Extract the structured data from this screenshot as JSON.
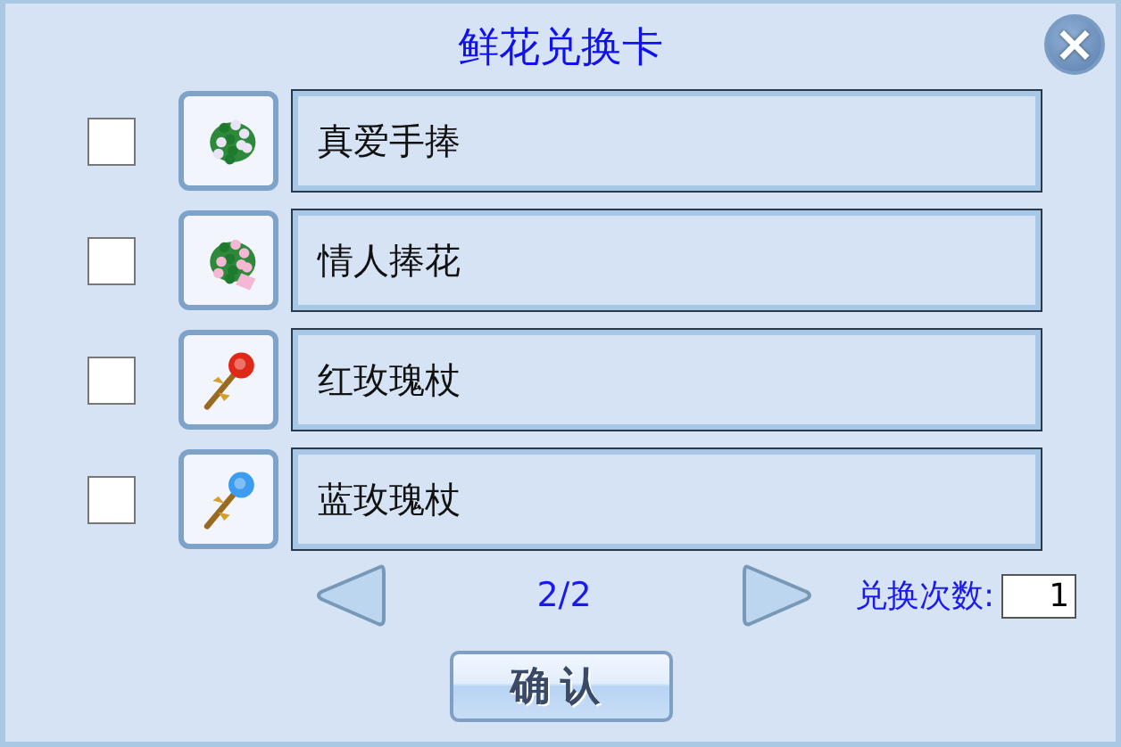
{
  "window": {
    "title": "鲜花兑换卡",
    "close": "×"
  },
  "items": [
    {
      "name": "真爱手捧",
      "kind": "bouquet",
      "color": "#e8e4f4",
      "checked": false
    },
    {
      "name": "情人捧花",
      "kind": "bouquet",
      "color": "#f4b8d4",
      "checked": false
    },
    {
      "name": "红玫瑰杖",
      "kind": "rose",
      "color": "#e02818",
      "checked": false
    },
    {
      "name": "蓝玫瑰杖",
      "kind": "rose",
      "color": "#3c9cf0",
      "checked": false
    }
  ],
  "pager": {
    "page": "2/2"
  },
  "count": {
    "label": "兑换次数:",
    "value": "1"
  },
  "buttons": [
    "确认"
  ]
}
